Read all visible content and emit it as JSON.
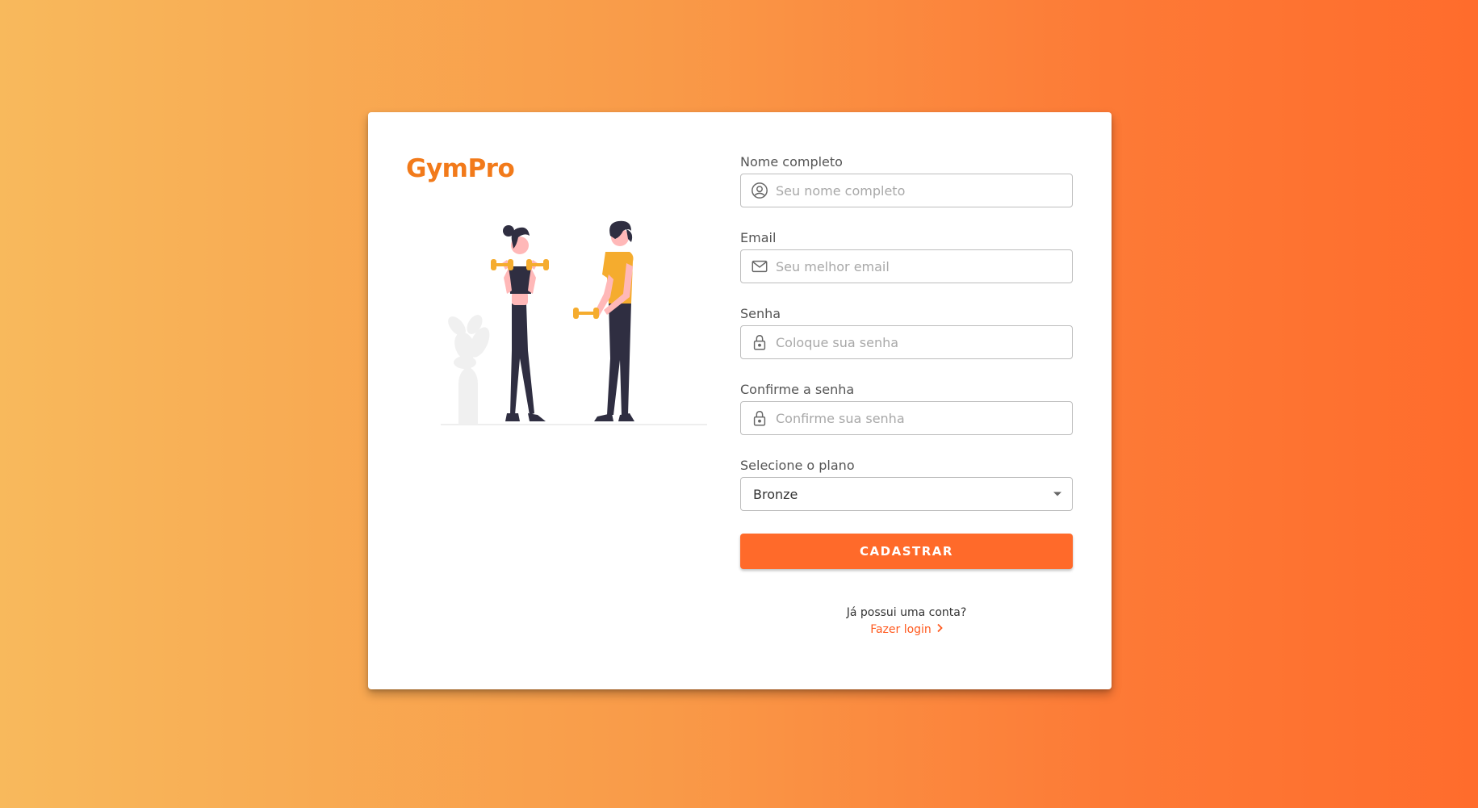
{
  "brand": {
    "name": "GymPro"
  },
  "form": {
    "full_name": {
      "label": "Nome completo",
      "placeholder": "Seu nome completo",
      "value": ""
    },
    "email": {
      "label": "Email",
      "placeholder": "Seu melhor email",
      "value": ""
    },
    "password": {
      "label": "Senha",
      "placeholder": "Coloque sua senha",
      "value": ""
    },
    "confirm_password": {
      "label": "Confirme a senha",
      "placeholder": "Confirme sua senha",
      "value": ""
    },
    "plan": {
      "label": "Selecione o plano",
      "selected": "Bronze"
    },
    "submit_label": "CADASTRAR"
  },
  "login": {
    "question": "Já possui uma conta?",
    "link_label": "Fazer login"
  },
  "icons": {
    "name_field": "user-circle-icon",
    "email_field": "envelope-icon",
    "password_field": "lock-icon",
    "confirm_field": "lock-icon",
    "select": "caret-down-icon",
    "login_link": "chevron-right-icon"
  },
  "colors": {
    "brand": "#f27a1a",
    "button": "#ff6a2a",
    "link": "#ff5a1f",
    "background_start": "#f8b95c",
    "background_end": "#ff6c2c",
    "illustration_accent": "#f5ac2e",
    "illustration_dark": "#2f2e41"
  }
}
